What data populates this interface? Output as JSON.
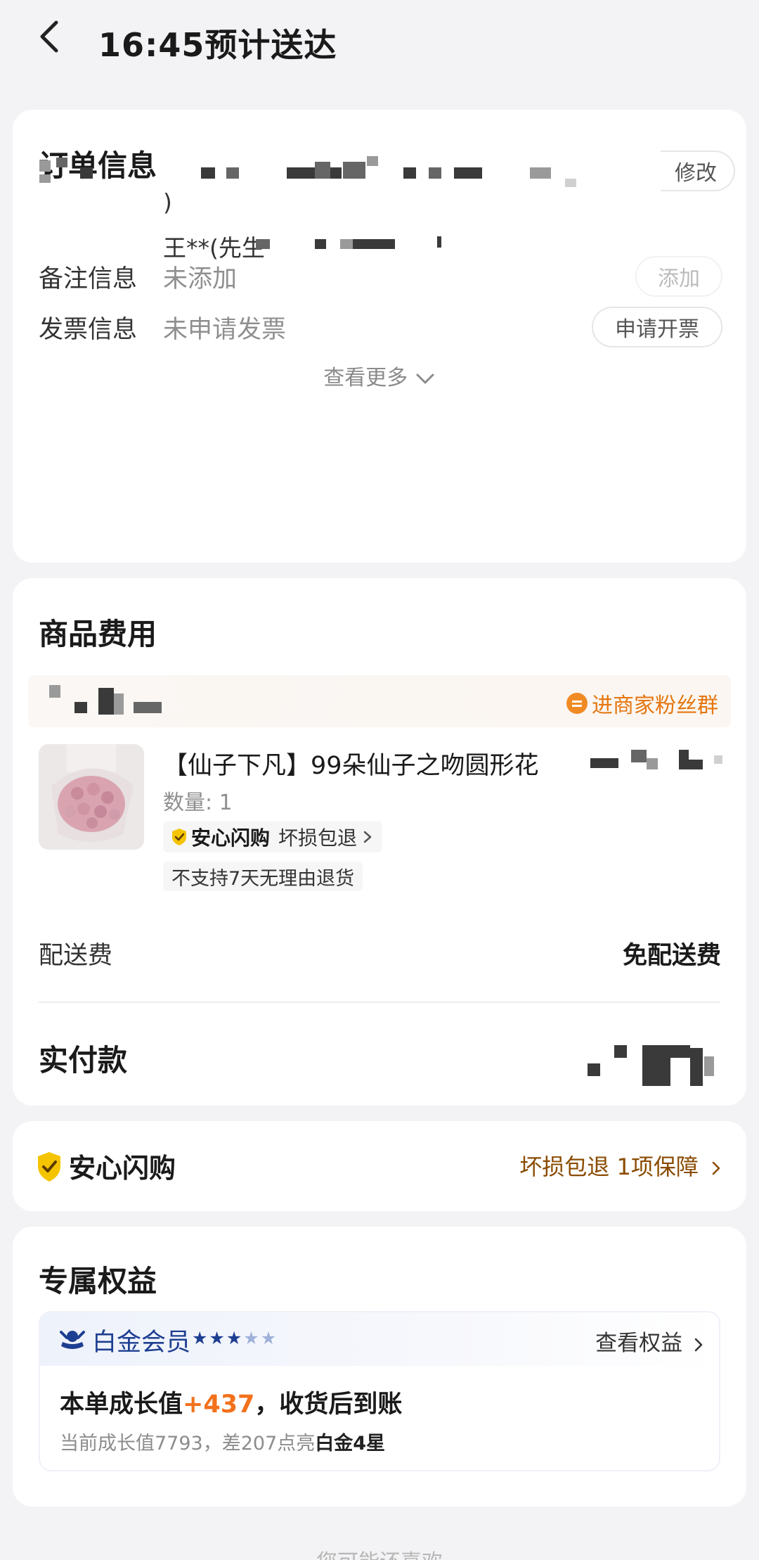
{
  "header": {
    "title": "16:45预计送达"
  },
  "order": {
    "title": "订单信息",
    "address_line2": ")",
    "contact": "王**(先生",
    "modify_label": "修改",
    "remark": {
      "label": "备注信息",
      "value": "未添加",
      "button": "添加"
    },
    "invoice": {
      "label": "发票信息",
      "value": "未申请发票",
      "button": "申请开票"
    },
    "see_more": "查看更多"
  },
  "goods": {
    "title": "商品费用",
    "fans_link": "进商家粉丝群",
    "product": {
      "name": "【仙子下凡】99朵仙子之吻圆形花",
      "qty": "数量: 1",
      "assure_brand": "安心闪购",
      "assure_tag": "坏损包退",
      "return_note": "不支持7天无理由退货"
    },
    "delivery": {
      "label": "配送费",
      "value": "免配送费"
    },
    "paid_label": "实付款"
  },
  "assurance": {
    "name": "安心闪购",
    "detail": "坏损包退 1项保障"
  },
  "privileges": {
    "title": "专属权益",
    "member_level": "白金会员",
    "stars_filled": 3,
    "stars_total": 5,
    "view_link": "查看权益",
    "growth_prefix": "本单成长值",
    "growth_value": "+437",
    "growth_suffix": "，收货后到账",
    "growth_current": "当前成长值7793，差207点亮",
    "growth_target": "白金4星"
  },
  "bottom_hint": "您可能还喜欢",
  "colors": {
    "accent_orange": "#f2711c",
    "member_blue": "#1d3f91",
    "assure_gold": "#f5c400"
  }
}
